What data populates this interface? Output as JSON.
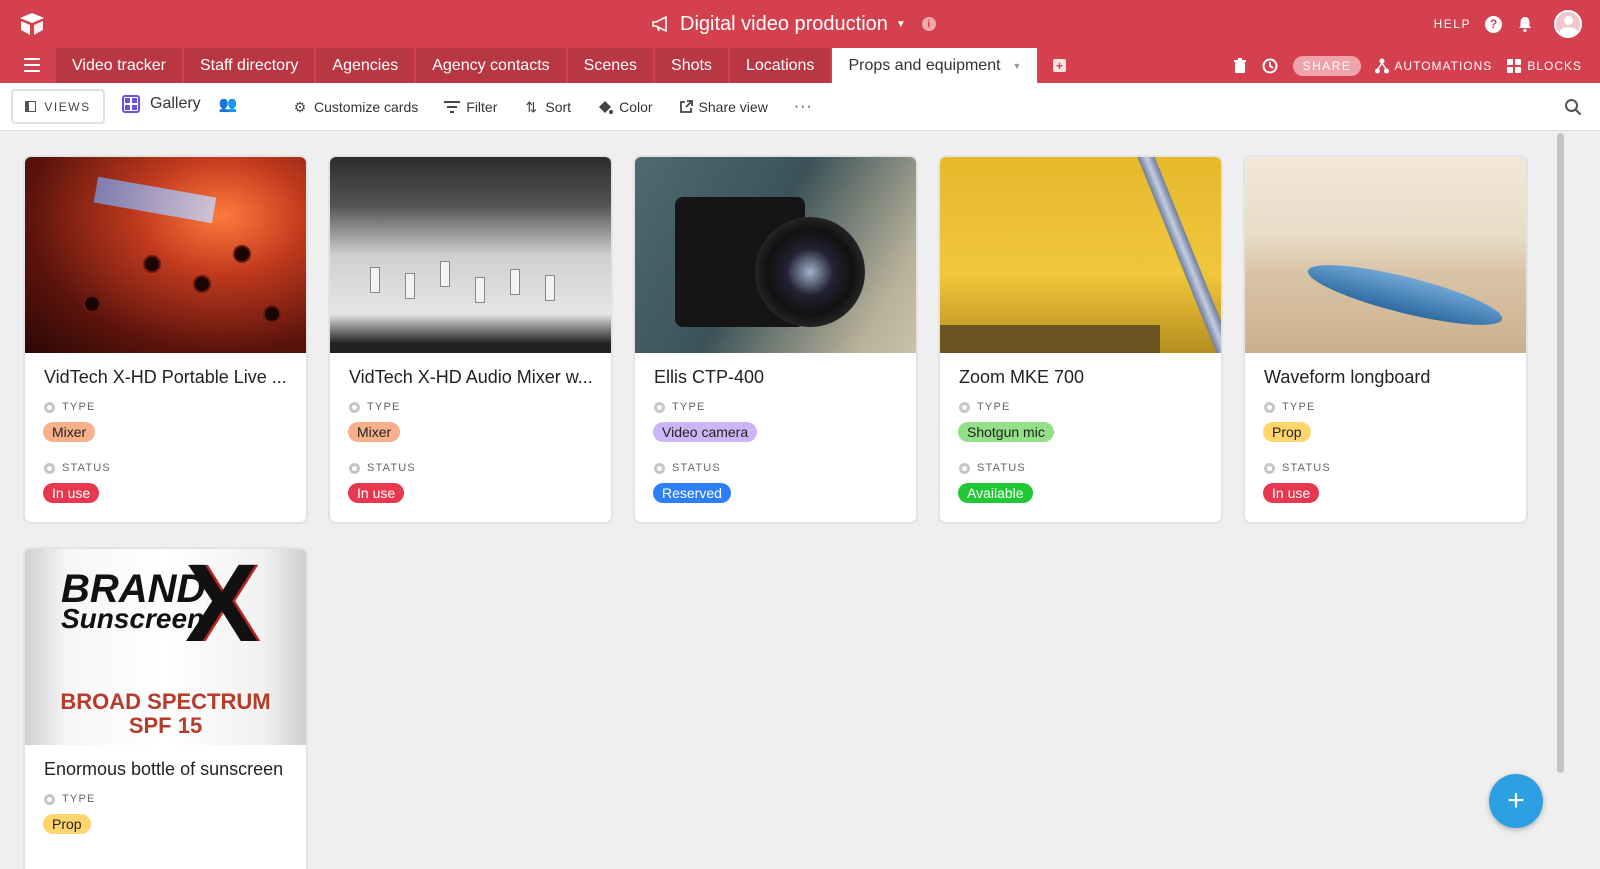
{
  "base": {
    "title": "Digital video production"
  },
  "header_right": {
    "help_label": "HELP"
  },
  "tabs": [
    {
      "label": "Video tracker"
    },
    {
      "label": "Staff directory"
    },
    {
      "label": "Agencies"
    },
    {
      "label": "Agency contacts"
    },
    {
      "label": "Scenes"
    },
    {
      "label": "Shots"
    },
    {
      "label": "Locations"
    },
    {
      "label": "Props and equipment",
      "active": true
    }
  ],
  "tab_actions": {
    "share": "SHARE",
    "automations": "AUTOMATIONS",
    "blocks": "BLOCKS"
  },
  "toolbar": {
    "views_label": "VIEWS",
    "view_name": "Gallery",
    "customize_cards": "Customize cards",
    "filter": "Filter",
    "sort": "Sort",
    "color": "Color",
    "share_view": "Share view",
    "more": "···"
  },
  "field_labels": {
    "type": "TYPE",
    "status": "STATUS"
  },
  "cards": [
    {
      "title": "VidTech X-HD Portable Live ...",
      "type": "Mixer",
      "type_color": "#f7b089",
      "status": "In use",
      "status_color": "#e8384f"
    },
    {
      "title": "VidTech X-HD Audio Mixer w...",
      "type": "Mixer",
      "type_color": "#f7b089",
      "status": "In use",
      "status_color": "#e8384f"
    },
    {
      "title": "Ellis CTP-400",
      "type": "Video camera",
      "type_color": "#cdb6f5",
      "status": "Reserved",
      "status_color": "#2d7ff9"
    },
    {
      "title": "Zoom MKE 700",
      "type": "Shotgun mic",
      "type_color": "#93e088",
      "status": "Available",
      "status_color": "#20c933"
    },
    {
      "title": "Waveform longboard",
      "type": "Prop",
      "type_color": "#ffd66e",
      "status": "In use",
      "status_color": "#e8384f"
    },
    {
      "title": "Enormous bottle of sunscreen",
      "type": "Prop",
      "type_color": "#ffd66e"
    }
  ],
  "sunscreen_image": {
    "brand": "BRAND",
    "sub": "Sunscreen",
    "letter": "X",
    "spec1": "BROAD SPECTRUM",
    "spec2": "SPF 15"
  },
  "colors": {
    "brand_red": "#d4404e",
    "tab_inactive": "#b93643",
    "fab_blue": "#2d9fe3",
    "gallery_icon": "#6b4fe0"
  },
  "icons": [
    "logo-icon",
    "megaphone-icon",
    "info-icon",
    "help-icon",
    "bell-icon",
    "avatar",
    "hamburger-icon",
    "add-table-icon",
    "trash-icon",
    "history-icon",
    "automations-icon",
    "blocks-icon",
    "gallery-icon",
    "people-icon",
    "gear-icon",
    "filter-icon",
    "sort-icon",
    "color-icon",
    "share-view-icon",
    "search-icon",
    "plus-icon"
  ]
}
